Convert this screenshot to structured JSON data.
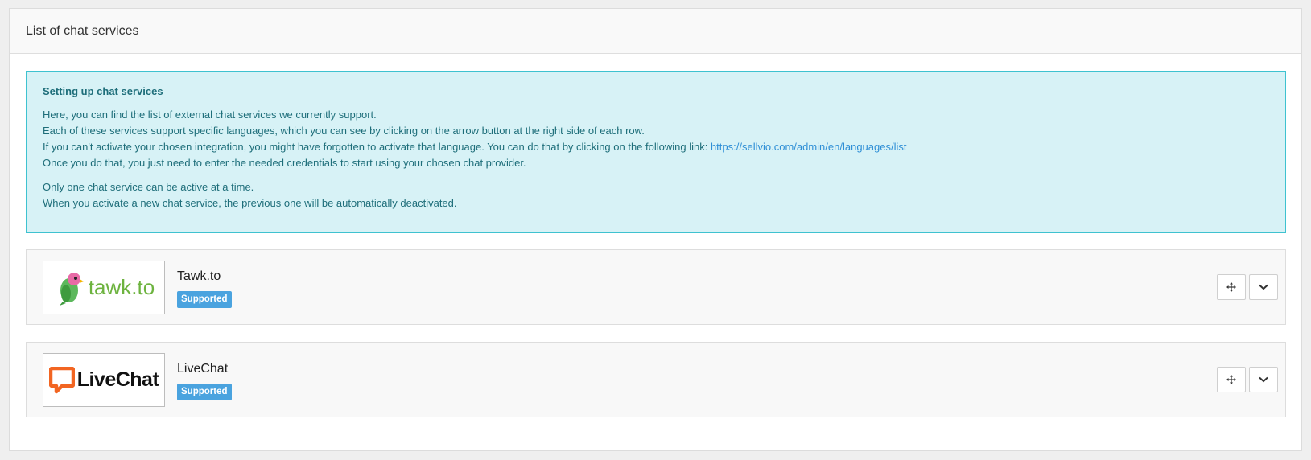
{
  "panel": {
    "title": "List of chat services"
  },
  "info": {
    "title": "Setting up chat services",
    "line1": "Here, you can find the list of external chat services we currently support.",
    "line2": "Each of these services support specific languages, which you can see by clicking on the arrow button at the right side of each row.",
    "line3_prefix": "If you can't activate your chosen integration, you might have forgotten to activate that language. You can do that by clicking on the following link: ",
    "line3_link": "https://sellvio.com/admin/en/languages/list",
    "line4": "Once you do that, you just need to enter the needed credentials to start using your chosen chat provider.",
    "line5": "Only one chat service can be active at a time.",
    "line6": "When you activate a new chat service, the previous one will be automatically deactivated."
  },
  "services": [
    {
      "name": "Tawk.to",
      "badge": "Supported",
      "logo_text": "tawk.to",
      "logo_icon": "parrot-icon"
    },
    {
      "name": "LiveChat",
      "badge": "Supported",
      "logo_text": "LiveChat",
      "logo_icon": "chat-bubble-icon"
    }
  ],
  "colors": {
    "info_bg": "#d7f2f6",
    "info_border": "#3ec2d0",
    "badge": "#4aa3df",
    "tawk_green": "#6db33f",
    "livechat_orange": "#f26522"
  }
}
